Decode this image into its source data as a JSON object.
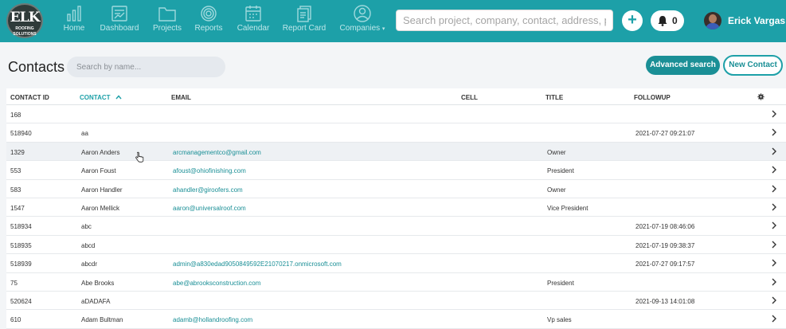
{
  "header": {
    "logo_line1": "ELK",
    "logo_line2": "ROOFING SOLUTIONS",
    "nav": [
      {
        "label": "Home",
        "icon": "bar-chart-icon"
      },
      {
        "label": "Dashboard",
        "icon": "dashboard-icon"
      },
      {
        "label": "Projects",
        "icon": "folder-icon"
      },
      {
        "label": "Reports",
        "icon": "target-icon"
      },
      {
        "label": "Calendar",
        "icon": "calendar-icon"
      },
      {
        "label": "Report Card",
        "icon": "report-card-icon"
      },
      {
        "label": "Companies",
        "icon": "user-icon"
      }
    ],
    "search_placeholder": "Search project, company, contact, address, phc",
    "plus_label": "+",
    "notification_count": "0",
    "user_name": "Erick Vargas",
    "accent": "#1da0a8"
  },
  "page": {
    "title": "Contacts",
    "search_placeholder": "Search by name...",
    "advanced_search_label": "Advanced search",
    "new_contact_label": "New Contact"
  },
  "table": {
    "columns": [
      "CONTACT ID",
      "CONTACT",
      "EMAIL",
      "CELL",
      "TITLE",
      "FOLLOWUP"
    ],
    "sorted_column": "CONTACT",
    "rows": [
      {
        "id": "168",
        "contact": "",
        "email": "",
        "cell": "",
        "title": "",
        "followup": ""
      },
      {
        "id": "518940",
        "contact": "aa",
        "email": "",
        "cell": "",
        "title": "",
        "followup": "2021-07-27 09:21:07"
      },
      {
        "id": "1329",
        "contact": "Aaron Anders",
        "email": "arcmanagementco@gmail.com",
        "cell": "",
        "title": "Owner",
        "followup": ""
      },
      {
        "id": "553",
        "contact": "Aaron Foust",
        "email": "afoust@ohiofinishing.com",
        "cell": "",
        "title": "President",
        "followup": ""
      },
      {
        "id": "583",
        "contact": "Aaron Handler",
        "email": "ahandler@giroofers.com",
        "cell": "",
        "title": "Owner",
        "followup": ""
      },
      {
        "id": "1547",
        "contact": "Aaron Mellick",
        "email": "aaron@universalroof.com",
        "cell": "",
        "title": "Vice President",
        "followup": ""
      },
      {
        "id": "518934",
        "contact": "abc",
        "email": "",
        "cell": "",
        "title": "",
        "followup": "2021-07-19 08:46:06"
      },
      {
        "id": "518935",
        "contact": "abcd",
        "email": "",
        "cell": "",
        "title": "",
        "followup": "2021-07-19 09:38:37"
      },
      {
        "id": "518939",
        "contact": "abcdr",
        "email": "admin@a830edad9050849592E21070217.onmicrosoft.com",
        "cell": "",
        "title": "",
        "followup": "2021-07-27 09:17:57"
      },
      {
        "id": "75",
        "contact": "Abe Brooks",
        "email": "abe@abrooksconstruction.com",
        "cell": "",
        "title": "President",
        "followup": ""
      },
      {
        "id": "520624",
        "contact": "aDADAFA",
        "email": "",
        "cell": "",
        "title": "",
        "followup": "2021-09-13 14:01:08"
      },
      {
        "id": "610",
        "contact": "Adam Bultman",
        "email": "adamb@hollandroofing.com",
        "cell": "",
        "title": "Vp sales",
        "followup": ""
      }
    ]
  }
}
